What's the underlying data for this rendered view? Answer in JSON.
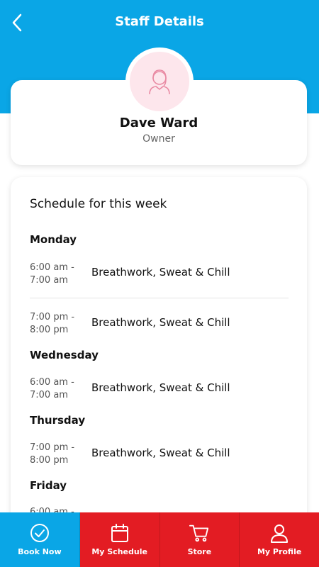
{
  "header": {
    "title": "Staff Details"
  },
  "staff": {
    "name": "Dave Ward",
    "role": "Owner"
  },
  "schedule": {
    "title": "Schedule for this week",
    "days": [
      {
        "day": "Monday",
        "entries": [
          {
            "time_start": "6:00 am -",
            "time_end": "7:00 am",
            "class": "Breathwork, Sweat & Chill"
          },
          {
            "time_start": "7:00 pm -",
            "time_end": "8:00 pm",
            "class": "Breathwork, Sweat & Chill"
          }
        ]
      },
      {
        "day": "Wednesday",
        "entries": [
          {
            "time_start": "6:00 am -",
            "time_end": "7:00 am",
            "class": "Breathwork, Sweat & Chill"
          }
        ]
      },
      {
        "day": "Thursday",
        "entries": [
          {
            "time_start": "7:00 pm -",
            "time_end": "8:00 pm",
            "class": "Breathwork, Sweat & Chill"
          }
        ]
      },
      {
        "day": "Friday",
        "entries": [
          {
            "time_start": "6:00 am -",
            "time_end": "",
            "class": ""
          }
        ]
      }
    ]
  },
  "nav": {
    "items": [
      {
        "label": "Book Now",
        "icon": "check-circle-icon"
      },
      {
        "label": "My Schedule",
        "icon": "calendar-icon"
      },
      {
        "label": "Store",
        "icon": "cart-icon"
      },
      {
        "label": "My Profile",
        "icon": "user-icon"
      }
    ]
  },
  "colors": {
    "primary": "#0aa6e6",
    "nav_red": "#e31c23",
    "avatar_bg": "#fde6ec",
    "avatar_line": "#e98aa3"
  }
}
